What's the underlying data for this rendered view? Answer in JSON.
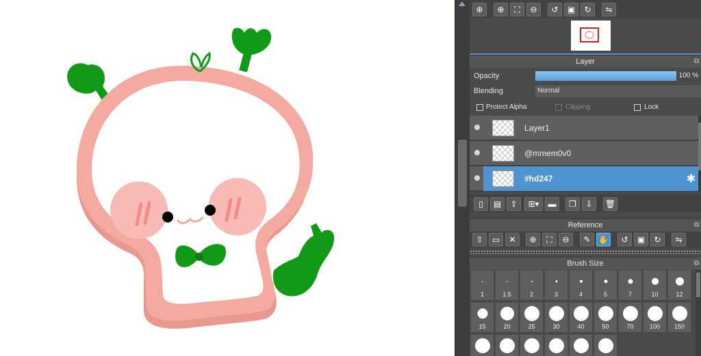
{
  "canvas": {
    "artwork_description_icon": "skull-character-icon",
    "colors": {
      "outline": "#f4aaa1",
      "outline_shadow": "#e8988e",
      "cheek": "#f9b9b7",
      "sprout": "#119a16",
      "eye": "#000000"
    }
  },
  "navigator": {
    "zoom_in_icon": "zoom-in-icon",
    "buttons": [
      "zoom-search-icon",
      "zoom-in-icon",
      "fit-screen-icon",
      "zoom-out-icon",
      "rotate-left-icon",
      "actual-size-icon",
      "rotate-right-icon",
      "flip-horizontal-icon"
    ]
  },
  "layer_panel": {
    "title": "Layer",
    "opacity_label": "Opacity",
    "opacity_value": "100 %",
    "opacity_percent": 100,
    "blending_label": "Blending",
    "blending_value": "Normal",
    "protect_alpha_label": "Protect Alpha",
    "clipping_label": "Clipping",
    "lock_label": "Lock",
    "layers": [
      {
        "name": "Layer1",
        "selected": false
      },
      {
        "name": "@mmem0v0",
        "selected": false
      },
      {
        "name": "#hd247",
        "selected": true
      }
    ],
    "actions": [
      "new-layer-icon",
      "new-raster-layer-icon",
      "import-layer-icon",
      "add-layer-menu-icon",
      "folder-icon",
      "duplicate-layer-icon",
      "merge-layer-icon",
      "delete-layer-icon"
    ]
  },
  "reference": {
    "title": "Reference",
    "buttons": [
      "upload-image-icon",
      "open-folder-icon",
      "close-icon",
      "zoom-in-icon",
      "fit-screen-icon",
      "zoom-out-icon",
      "eyedropper-icon",
      "hand-icon",
      "rotate-left-icon",
      "actual-size-icon",
      "rotate-right-icon",
      "flip-horizontal-icon"
    ],
    "active_button": "hand-icon"
  },
  "brush_size": {
    "title": "Brush Size",
    "sizes": [
      "1",
      "1.5",
      "2",
      "3",
      "4",
      "5",
      "7",
      "10",
      "12",
      "15",
      "20",
      "25",
      "30",
      "40",
      "50",
      "70",
      "100",
      "150",
      "",
      "",
      "",
      "",
      "",
      ""
    ]
  }
}
